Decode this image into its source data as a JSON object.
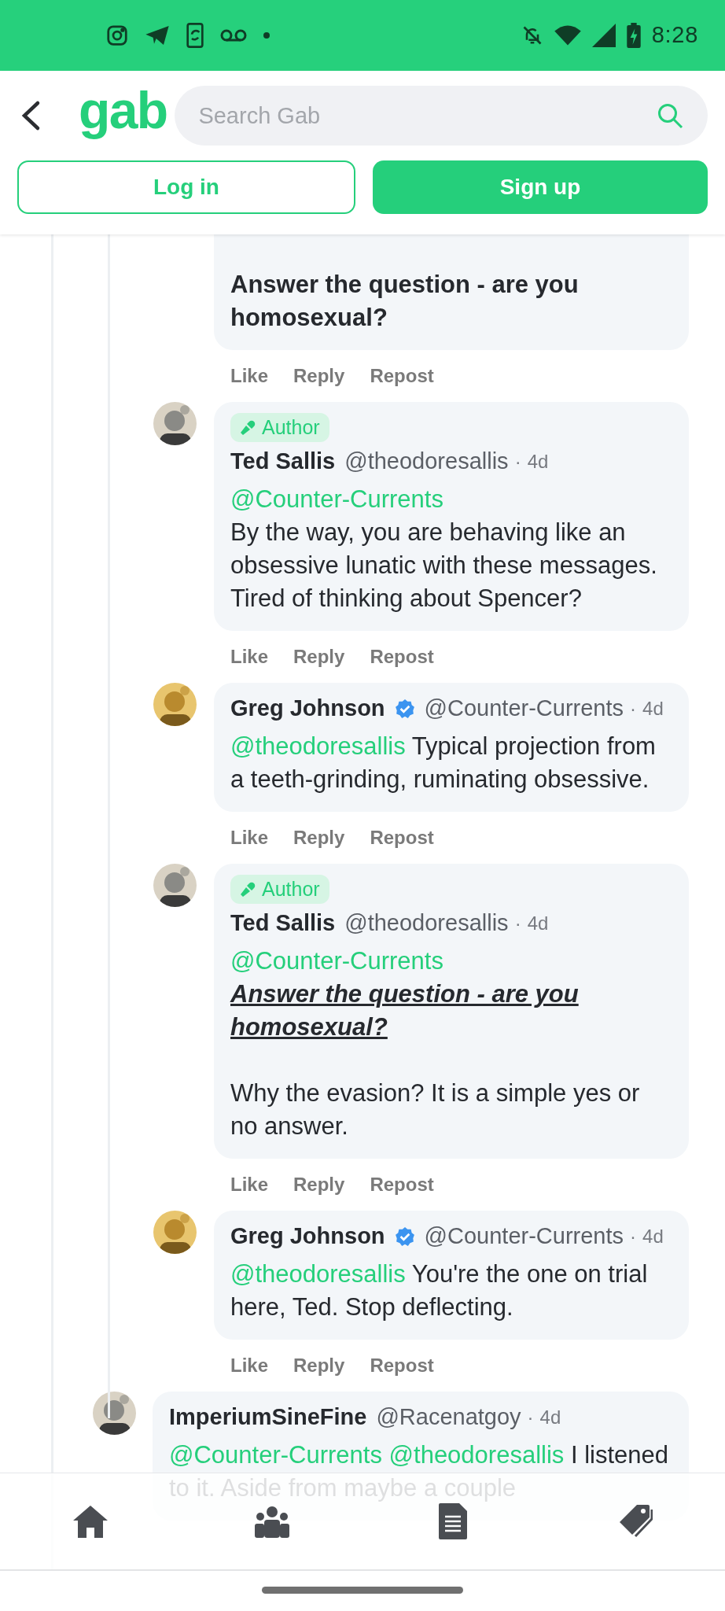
{
  "status_bar": {
    "time": "8:28"
  },
  "header": {
    "logo": "gab",
    "search": {
      "placeholder": "Search Gab"
    },
    "buttons": [
      {
        "label": "Log in",
        "kind": "outline"
      },
      {
        "label": "Sign up",
        "kind": "filled"
      }
    ]
  },
  "thread": {
    "replies": [
      {
        "paragraphs": [
          {
            "parts": [
              {
                "kind": "strong",
                "text": "Answer the question - are you homosexual?"
              }
            ]
          }
        ],
        "actions": [
          "Like",
          "Reply",
          "Repost"
        ]
      },
      {
        "avatar": {
          "kind": "picture"
        },
        "badge": "Author",
        "name": "Ted Sallis",
        "verified": false,
        "handle": "@theodoresallis",
        "separator": "·",
        "time": "4d",
        "paragraphs": [
          {
            "parts": [
              {
                "kind": "mention",
                "text": "@Counter-Currents"
              }
            ]
          },
          {
            "parts": [
              {
                "kind": "text",
                "text": "By the way, you are behaving like an obsessive lunatic with these messages. Tired of thinking about Spencer?"
              }
            ]
          }
        ],
        "actions": [
          "Like",
          "Reply",
          "Repost"
        ]
      },
      {
        "avatar": {
          "kind": "picture"
        },
        "name": "Greg Johnson",
        "verified": true,
        "handle": "@Counter-Currents",
        "separator": "·",
        "time": "4d",
        "paragraphs": [
          {
            "parts": [
              {
                "kind": "mention",
                "text": "@theodoresallis"
              },
              {
                "kind": "text",
                "text": " Typical projection from a teeth-grinding, ruminating obsessive."
              }
            ]
          }
        ],
        "actions": [
          "Like",
          "Reply",
          "Repost"
        ]
      },
      {
        "avatar": {
          "kind": "picture"
        },
        "badge": "Author",
        "name": "Ted Sallis",
        "verified": false,
        "handle": "@theodoresallis",
        "separator": "·",
        "time": "4d",
        "paragraphs": [
          {
            "parts": [
              {
                "kind": "mention",
                "text": "@Counter-Currents"
              }
            ]
          },
          {
            "parts": [
              {
                "kind": "emphasis",
                "text": "Answer the question - are you homosexual?"
              }
            ]
          },
          {
            "blank_line_before": true,
            "parts": [
              {
                "kind": "text",
                "text": "Why the evasion? It is a simple yes or no answer."
              }
            ]
          }
        ],
        "actions": [
          "Like",
          "Reply",
          "Repost"
        ]
      },
      {
        "avatar": {
          "kind": "picture"
        },
        "name": "Greg Johnson",
        "verified": true,
        "handle": "@Counter-Currents",
        "separator": "·",
        "time": "4d",
        "paragraphs": [
          {
            "parts": [
              {
                "kind": "mention",
                "text": "@theodoresallis"
              },
              {
                "kind": "text",
                "text": " You're the one on trial here, Ted. Stop deflecting."
              }
            ]
          }
        ],
        "actions": [
          "Like",
          "Reply",
          "Repost"
        ]
      }
    ],
    "following_comments": [
      {
        "avatar": {
          "kind": "picture"
        },
        "name": "ImperiumSineFine",
        "verified": false,
        "handle": "@Racenatgoy",
        "separator": "·",
        "time": "4d",
        "paragraphs": [
          {
            "parts": [
              {
                "kind": "mention",
                "text": "@Counter-Currents @theodoresallis"
              },
              {
                "kind": "text",
                "text": " I listened to it. Aside from maybe a couple"
              }
            ]
          }
        ]
      }
    ]
  },
  "bottom_nav": [
    {
      "kind": "home"
    },
    {
      "kind": "groups"
    },
    {
      "kind": "news"
    },
    {
      "kind": "shop"
    }
  ]
}
